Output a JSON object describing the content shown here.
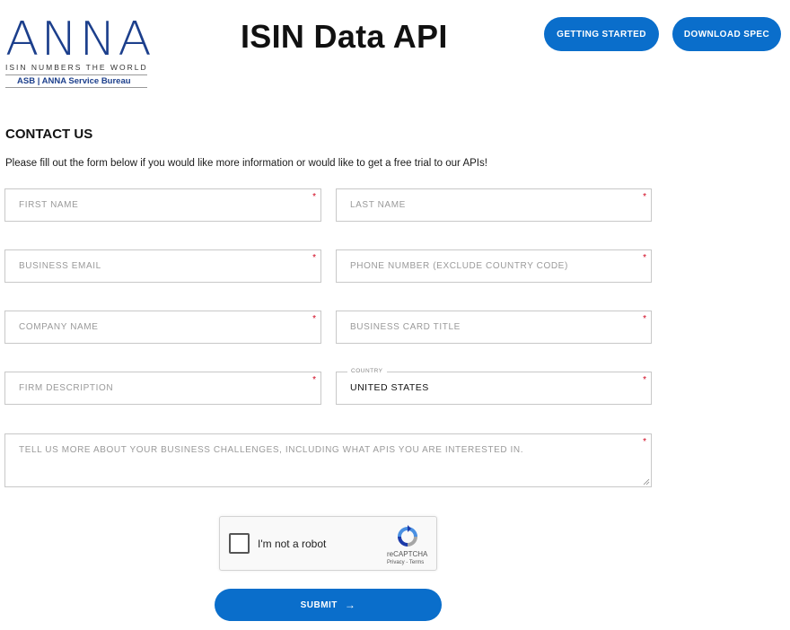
{
  "header": {
    "logo": {
      "letters": "ANNA",
      "tagline": "ISIN NUMBERS THE WORLD",
      "sub": "ASB | ANNA Service Bureau",
      "brand_color": "#1c3f8c"
    },
    "title": "ISIN Data API",
    "buttons": {
      "getting_started": "GETTING STARTED",
      "download_spec": "DOWNLOAD SPEC"
    },
    "accent_color": "#0a6ecb"
  },
  "contact": {
    "heading": "CONTACT US",
    "intro": "Please fill out the form below if you would like more information or would like to get a free trial to our APIs!"
  },
  "form": {
    "required_mark": "*",
    "first_name": {
      "placeholder": "FIRST NAME"
    },
    "last_name": {
      "placeholder": "LAST NAME"
    },
    "business_email": {
      "placeholder": "BUSINESS EMAIL"
    },
    "phone": {
      "placeholder": "PHONE NUMBER (EXCLUDE COUNTRY CODE)"
    },
    "company_name": {
      "placeholder": "COMPANY NAME"
    },
    "card_title": {
      "placeholder": "BUSINESS CARD TITLE"
    },
    "firm_description": {
      "placeholder": "FIRM DESCRIPTION"
    },
    "country": {
      "label": "COUNTRY",
      "value": "UNITED STATES"
    },
    "challenges": {
      "placeholder": "TELL US MORE ABOUT YOUR BUSINESS CHALLENGES, INCLUDING WHAT APIS YOU ARE INTERESTED IN."
    }
  },
  "captcha": {
    "label": "I'm not a robot",
    "brand": "reCAPTCHA",
    "links": "Privacy - Terms",
    "icon": "recaptcha-icon"
  },
  "submit": {
    "label": "SUBMIT",
    "icon": "arrow-right-icon"
  }
}
